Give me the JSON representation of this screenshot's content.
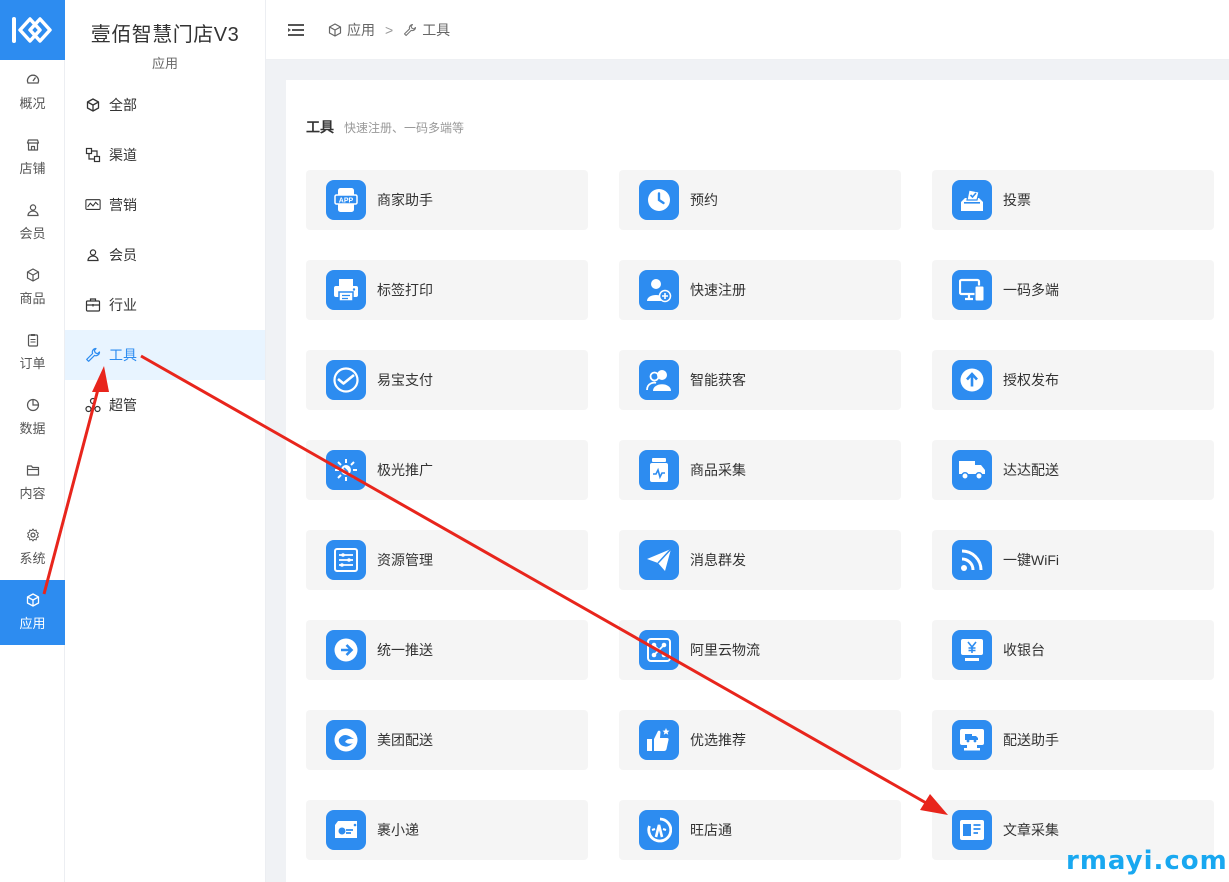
{
  "rail": {
    "items": [
      {
        "label": "概况",
        "icon": "dashboard-icon"
      },
      {
        "label": "店铺",
        "icon": "store-icon"
      },
      {
        "label": "会员",
        "icon": "user-icon"
      },
      {
        "label": "商品",
        "icon": "box-icon"
      },
      {
        "label": "订单",
        "icon": "clipboard-icon"
      },
      {
        "label": "数据",
        "icon": "pie-chart-icon"
      },
      {
        "label": "内容",
        "icon": "folder-icon"
      },
      {
        "label": "系统",
        "icon": "gear-icon"
      },
      {
        "label": "应用",
        "icon": "cube-icon",
        "active": true
      }
    ]
  },
  "sidebar": {
    "shop_name": "壹佰智慧门店V3",
    "subtitle": "应用",
    "items": [
      {
        "label": "全部",
        "icon": "cube-icon"
      },
      {
        "label": "渠道",
        "icon": "channel-icon"
      },
      {
        "label": "营销",
        "icon": "monitor-chart-icon"
      },
      {
        "label": "会员",
        "icon": "user-icon"
      },
      {
        "label": "行业",
        "icon": "briefcase-icon"
      },
      {
        "label": "工具",
        "icon": "wrench-icon",
        "active": true
      },
      {
        "label": "超管",
        "icon": "admin-icon"
      }
    ]
  },
  "breadcrumb": {
    "root": "应用",
    "separator": ">",
    "current": "工具"
  },
  "section": {
    "title": "工具",
    "desc": "快速注册、一码多端等"
  },
  "cards": [
    {
      "label": "商家助手",
      "icon": "app-icon"
    },
    {
      "label": "预约",
      "icon": "clock-icon"
    },
    {
      "label": "投票",
      "icon": "ballot-box-icon"
    },
    {
      "label": "标签打印",
      "icon": "printer-icon"
    },
    {
      "label": "快速注册",
      "icon": "user-add-icon"
    },
    {
      "label": "一码多端",
      "icon": "devices-icon"
    },
    {
      "label": "易宝支付",
      "icon": "check-chat-icon"
    },
    {
      "label": "智能获客",
      "icon": "users-icon"
    },
    {
      "label": "授权发布",
      "icon": "upload-icon"
    },
    {
      "label": "极光推广",
      "icon": "aurora-icon"
    },
    {
      "label": "商品采集",
      "icon": "jar-icon"
    },
    {
      "label": "达达配送",
      "icon": "truck-icon"
    },
    {
      "label": "资源管理",
      "icon": "list-settings-icon"
    },
    {
      "label": "消息群发",
      "icon": "send-icon"
    },
    {
      "label": "一键WiFi",
      "icon": "wifi-icon"
    },
    {
      "label": "统一推送",
      "icon": "arrow-right-circle-icon"
    },
    {
      "label": "阿里云物流",
      "icon": "logistics-icon"
    },
    {
      "label": "收银台",
      "icon": "cashier-icon"
    },
    {
      "label": "美团配送",
      "icon": "meituan-icon"
    },
    {
      "label": "优选推荐",
      "icon": "thumbs-up-icon"
    },
    {
      "label": "配送助手",
      "icon": "delivery-monitor-icon"
    },
    {
      "label": "裹小递",
      "icon": "parcel-icon"
    },
    {
      "label": "旺店通",
      "icon": "wangdian-icon"
    },
    {
      "label": "文章采集",
      "icon": "article-icon"
    }
  ],
  "watermark": "rmayi.com",
  "colors": {
    "accent": "#2d8cf0",
    "active_bg": "#e8f4ff",
    "card_bg": "#f5f5f5",
    "annotation_red": "#e8251c"
  }
}
